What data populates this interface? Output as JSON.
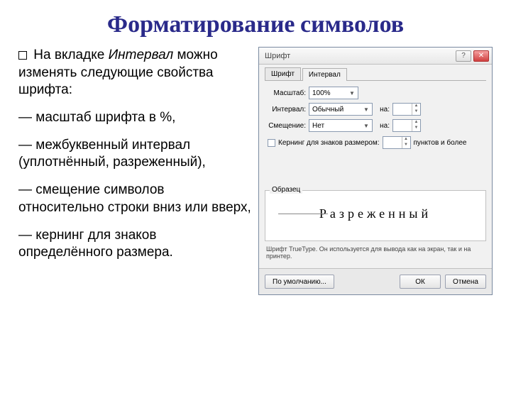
{
  "title": "Форматирование символов",
  "left": {
    "intro_pre": "На вкладке ",
    "intro_tab": "Интервал",
    "intro_post": " можно изменять следующие свойства шрифта:",
    "li1": "— масштаб шрифта в %,",
    "li2": "— межбуквенный интервал (уплотнённый, разреженный),",
    "li3": "— смещение символов относительно строки вниз или вверх,",
    "li4": "— кернинг для знаков определённого размера."
  },
  "dialog": {
    "title": "Шрифт",
    "tabs": {
      "t1": "Шрифт",
      "t2": "Интервал"
    },
    "rows": {
      "scale_label": "Масштаб:",
      "scale_value": "100%",
      "interval_label": "Интервал:",
      "interval_value": "Обычный",
      "na_label": "на:",
      "shift_label": "Смещение:",
      "shift_value": "Нет"
    },
    "kerning": {
      "label": "Кернинг для знаков размером:",
      "unit": "пунктов и более"
    },
    "sample": {
      "label": "Образец",
      "text": "Разреженный"
    },
    "desc": "Шрифт TrueType. Он используется для вывода как на экран, так и на принтер.",
    "buttons": {
      "default": "По умолчанию...",
      "ok": "ОК",
      "cancel": "Отмена"
    }
  }
}
